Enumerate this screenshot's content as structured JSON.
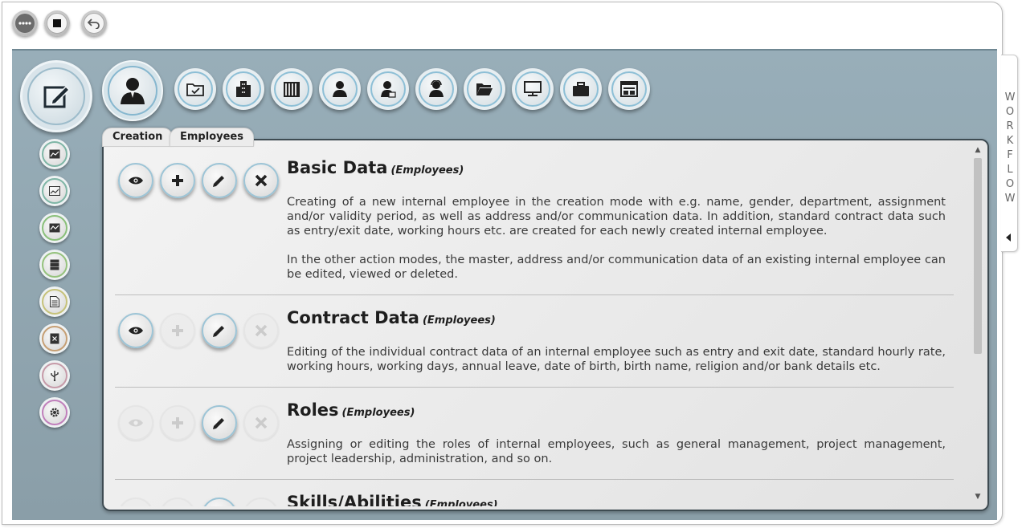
{
  "toolbar": {
    "buttons": [
      {
        "icon": "more-dots-icon"
      },
      {
        "icon": "stop-icon"
      },
      {
        "icon": "undo-icon"
      }
    ]
  },
  "modules": {
    "main_icon": "edit-icon",
    "active_icon": "employee-icon",
    "icons": [
      "folder-check-icon",
      "building-icon",
      "office-building-icon",
      "person-icon",
      "person-card-icon",
      "person-headset-icon",
      "folder-open-icon",
      "monitor-icon",
      "briefcase-icon",
      "window-icon"
    ]
  },
  "sidebar": {
    "items": [
      {
        "icon": "image-chart-icon",
        "color": "#7fb6a6"
      },
      {
        "icon": "area-chart-icon",
        "color": "#7fb6a6"
      },
      {
        "icon": "line-chart-icon",
        "color": "#8ac07a"
      },
      {
        "icon": "server-icon",
        "color": "#95c27c"
      },
      {
        "icon": "document-icon",
        "color": "#c6c27a"
      },
      {
        "icon": "delete-document-icon",
        "color": "#c69f74"
      },
      {
        "icon": "usb-icon",
        "color": "#c69aa8"
      },
      {
        "icon": "settings-icon",
        "color": "#c07fbb"
      }
    ]
  },
  "tabs": [
    {
      "label": "Creation"
    },
    {
      "label": "Employees"
    }
  ],
  "sections": [
    {
      "title": "Basic Data",
      "subtitle": "(Employees)",
      "actions": {
        "view": true,
        "add": true,
        "edit": true,
        "delete": true
      },
      "paragraphs": [
        "Creating of a new internal employee in the creation mode with e.g. name, gender, department, assignment and/or validity period, as well as address and/or communication data. In addition, standard contract data such as entry/exit date, working hours etc. are created for each newly created internal employee.",
        "In the other action modes, the master, address and/or communication data of an existing internal employee can be edited, viewed or deleted."
      ]
    },
    {
      "title": "Contract Data",
      "subtitle": "(Employees)",
      "actions": {
        "view": true,
        "add": false,
        "edit": true,
        "delete": false
      },
      "paragraphs": [
        "Editing of the individual contract data of an internal employee such as entry and exit date, standard hourly rate, working hours, working days, annual leave, date of birth, birth name, religion and/or bank details etc."
      ]
    },
    {
      "title": "Roles",
      "subtitle": "(Employees)",
      "actions": {
        "view": false,
        "add": false,
        "edit": true,
        "delete": false
      },
      "paragraphs": [
        "Assigning or editing the roles of internal employees, such as general management, project management, project leadership, administration, and so on."
      ]
    },
    {
      "title": "Skills/Abilities",
      "subtitle": "(Employees)",
      "actions": {
        "view": false,
        "add": false,
        "edit": true,
        "delete": false
      },
      "paragraphs": []
    }
  ],
  "workflow": {
    "label": "WORKFLOW"
  }
}
